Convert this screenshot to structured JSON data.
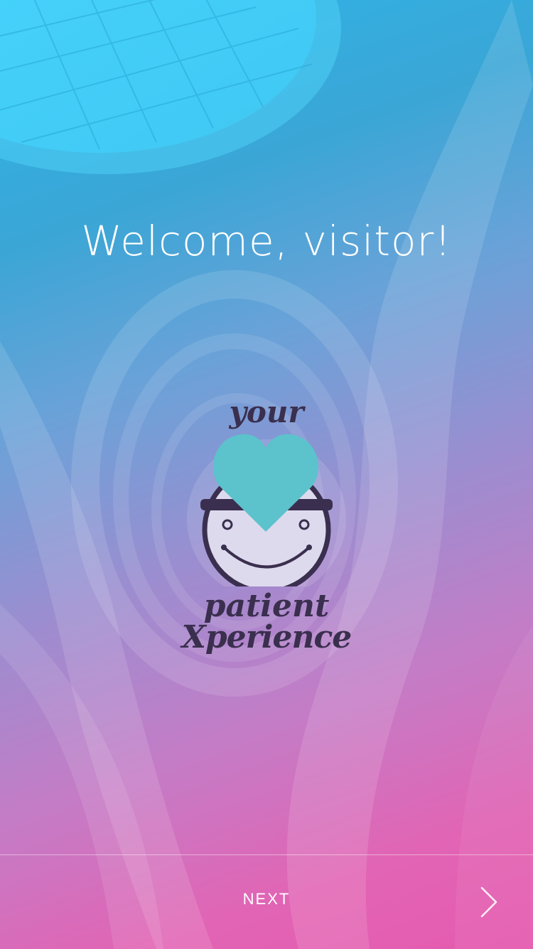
{
  "welcome": {
    "title": "Welcome, visitor!"
  },
  "logo": {
    "word_top": "your",
    "word_bottom_1": "patient",
    "word_bottom_2": "Xperience",
    "heart_color": "#5cc2cb",
    "face_color": "#dedaee",
    "text_color": "#3a2f4e"
  },
  "footer": {
    "next_label": "NEXT",
    "next_icon": "chevron-right-icon"
  },
  "colors": {
    "gradient_top": "#2eb6ea",
    "gradient_bottom": "#e55aaf",
    "text": "#ffffff"
  }
}
